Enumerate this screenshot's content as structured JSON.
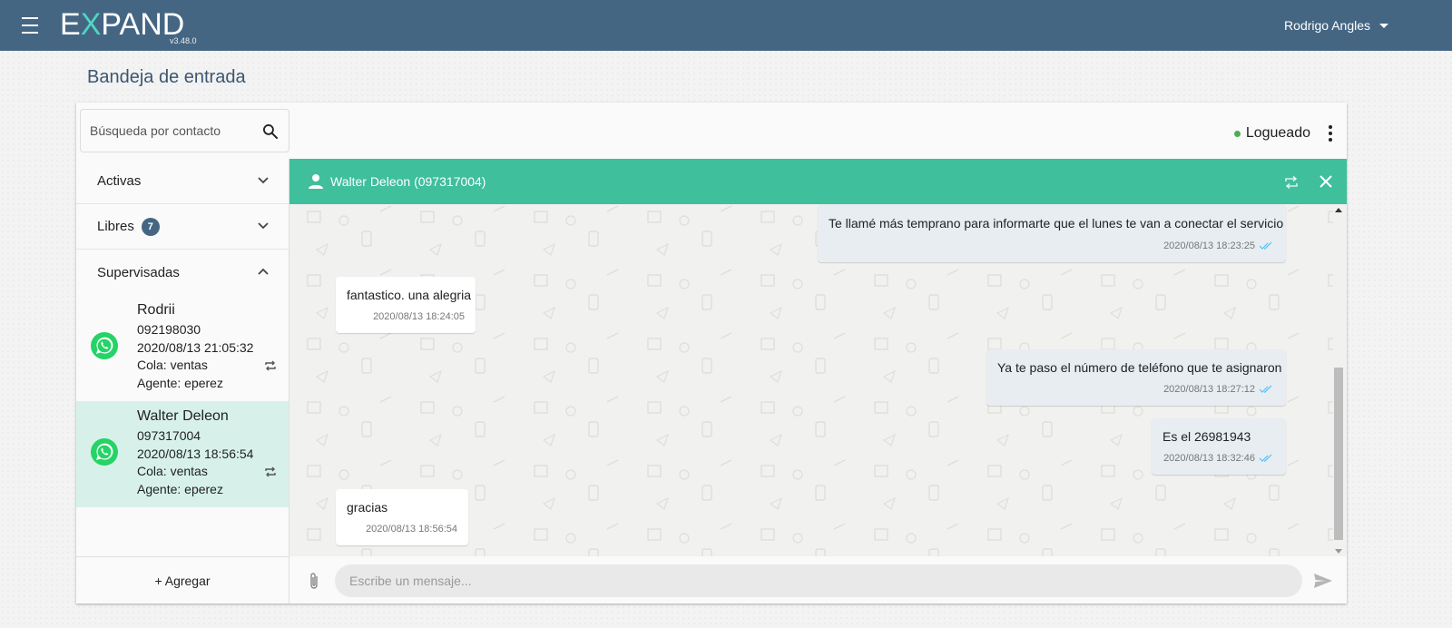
{
  "app": {
    "brand_prefix": "E",
    "brand_x": "X",
    "brand_rest": "PAND",
    "version": "v3.48.0",
    "user_name": "Rodrigo Angles"
  },
  "page": {
    "title": "Bandeja de entrada"
  },
  "search": {
    "placeholder": "Búsqueda por contacto"
  },
  "status": {
    "label": "Logueado",
    "color": "#4caf50"
  },
  "sidebar": {
    "groups": [
      {
        "label": "Activas",
        "expanded": false
      },
      {
        "label": "Libres",
        "badge": "7",
        "expanded": false
      },
      {
        "label": "Supervisadas",
        "expanded": true
      }
    ],
    "contacts": [
      {
        "name": "Rodrii",
        "phone": "092198030",
        "datetime": "2020/08/13 21:05:32",
        "queue": "Cola: ventas",
        "agent": "Agente: eperez",
        "active": false
      },
      {
        "name": "Walter Deleon",
        "phone": "097317004",
        "datetime": "2020/08/13 18:56:54",
        "queue": "Cola: ventas",
        "agent": "Agente: eperez",
        "active": true
      }
    ],
    "add_label": "+ Agregar"
  },
  "chat": {
    "header_title": "Walter Deleon (097317004)",
    "header_color": "#3fbf9c",
    "messages": [
      {
        "direction": "out",
        "text": "Te llamé más temprano para informarte que el lunes te van a conectar el servicio",
        "time": "2020/08/13 18:23:25",
        "read": true
      },
      {
        "direction": "in",
        "text": "fantastico. una alegria",
        "time": "2020/08/13 18:24:05"
      },
      {
        "direction": "out",
        "text": "Ya te paso el número de teléfono que te asignaron",
        "time": "2020/08/13 18:27:12",
        "read": true
      },
      {
        "direction": "out",
        "text": "Es el 26981943",
        "time": "2020/08/13 18:32:46",
        "read": true
      },
      {
        "direction": "in",
        "text": "gracias",
        "time": "2020/08/13 18:56:54"
      }
    ],
    "composer_placeholder": "Escribe un mensaje..."
  },
  "colors": {
    "topbar": "#456683",
    "accent": "#3fbf9c",
    "active_row": "#d7f1ea",
    "read_ticks": "#4fc3f7"
  }
}
